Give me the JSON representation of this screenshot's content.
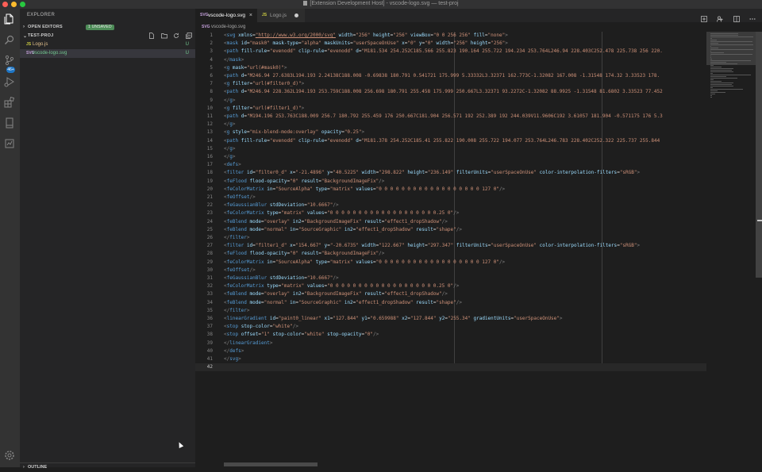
{
  "window": {
    "title": "[Extension Development Host] - vscode-logo.svg — test-proj"
  },
  "activity_bar": {
    "items": [
      "explorer-icon",
      "search-icon",
      "source-control-icon",
      "run-debug-icon",
      "extensions-icon",
      "notebook-icon",
      "test-icon"
    ],
    "source_control_badge": "46+",
    "settings": "gear-icon"
  },
  "sidebar": {
    "title": "EXPLORER",
    "open_editors": {
      "label": "OPEN EDITORS",
      "badge": "1 UNSAVED"
    },
    "project": {
      "label": "TEST-PROJ",
      "files": [
        {
          "icon": "JS",
          "name": "Logo.js",
          "status": "U",
          "color": "#e2c08d"
        },
        {
          "icon": "SVG",
          "name": "vscode-logo.svg",
          "status": "U",
          "color": "#73c991"
        }
      ]
    },
    "outline": {
      "label": "OUTLINE"
    }
  },
  "tabs": [
    {
      "icon": "SVG",
      "label": "vscode-logo.svg",
      "close": "×"
    },
    {
      "icon": "JS",
      "label": "Logo.js"
    }
  ],
  "breadcrumb": {
    "icon": "SVG",
    "label": "vscode-logo.svg"
  },
  "editor": {
    "current_line": 42,
    "lines": [
      "<svg xmlns=\"http://www.w3.org/2000/svg\" width=\"256\" height=\"256\" viewBox=\"0 0 256 256\" fill=\"none\">",
      "<mask id=\"mask0\" mask-type=\"alpha\" maskUnits=\"userSpaceOnUse\" x=\"0\" y=\"0\" width=\"256\" height=\"256\">",
      "<path fill-rule=\"evenodd\" clip-rule=\"evenodd\" d=\"M181.534 254.252C185.566 255.823 190.164 255.722 194.234 253.764L246.94 228.403C252.478 225.738 256 220.",
      "</mask>",
      "<g mask=\"url(#mask0)\">",
      "<path d=\"M246.94 27.6383L194.193 2.24138C188.008 -0.69838 180.791 0.541721 175.999 5.33332L3.32371 162.773C-1.32082 167.008 -1.31548 174.32 3.33523 178.",
      "<g filter=\"url(#filter0_d)\">",
      "<path d=\"M246.94 228.362L194.193 253.759C188.008 256.698 180.791 255.458 175.999 250.667L3.32371 93.2272C-1.32082 88.9925 -1.31548 81.6802 3.33523 77.452",
      "</g>",
      "<g filter=\"url(#filter1_d)\">",
      "<path d=\"M194.196 253.763C188.009 256.7 180.792 255.459 176 250.667C181.904 256.571 192 252.389 192 244.039V11.9606C192 3.61057 181.904 -0.571175 176 5.3",
      "</g>",
      "<g style=\"mix-blend-mode:overlay\" opacity=\"0.25\">",
      "<path fill-rule=\"evenodd\" clip-rule=\"evenodd\" d=\"M181.378 254.252C185.41 255.822 190.008 255.722 194.077 253.764L246.783 228.402C252.322 225.737 255.844",
      "</g>",
      "</g>",
      "<defs>",
      "<filter id=\"filter0_d\" x=\"-21.4896\" y=\"40.5225\" width=\"298.822\" height=\"236.149\" filterUnits=\"userSpaceOnUse\" color-interpolation-filters=\"sRGB\">",
      "<feFlood flood-opacity=\"0\" result=\"BackgroundImageFix\"/>",
      "<feColorMatrix in=\"SourceAlpha\" type=\"matrix\" values=\"0 0 0 0 0 0 0 0 0 0 0 0 0 0 0 0 0 0 127 0\"/>",
      "<feOffset/>",
      "<feGaussianBlur stdDeviation=\"10.6667\"/>",
      "<feColorMatrix type=\"matrix\" values=\"0 0 0 0 0 0 0 0 0 0 0 0 0 0 0 0 0 0 0.25 0\"/>",
      "<feBlend mode=\"overlay\" in2=\"BackgroundImageFix\" result=\"effect1_dropShadow\"/>",
      "<feBlend mode=\"normal\" in=\"SourceGraphic\" in2=\"effect1_dropShadow\" result=\"shape\"/>",
      "</filter>",
      "<filter id=\"filter1_d\" x=\"154.667\" y=\"-20.6735\" width=\"122.667\" height=\"297.347\" filterUnits=\"userSpaceOnUse\" color-interpolation-filters=\"sRGB\">",
      "<feFlood flood-opacity=\"0\" result=\"BackgroundImageFix\"/>",
      "<feColorMatrix in=\"SourceAlpha\" type=\"matrix\" values=\"0 0 0 0 0 0 0 0 0 0 0 0 0 0 0 0 0 0 127 0\"/>",
      "<feOffset/>",
      "<feGaussianBlur stdDeviation=\"10.6667\"/>",
      "<feColorMatrix type=\"matrix\" values=\"0 0 0 0 0 0 0 0 0 0 0 0 0 0 0 0 0 0 0.25 0\"/>",
      "<feBlend mode=\"overlay\" in2=\"BackgroundImageFix\" result=\"effect1_dropShadow\"/>",
      "<feBlend mode=\"normal\" in=\"SourceGraphic\" in2=\"effect1_dropShadow\" result=\"shape\"/>",
      "</filter>",
      "<linearGradient id=\"paint0_linear\" x1=\"127.844\" y1=\"0.659988\" x2=\"127.844\" y2=\"255.34\" gradientUnits=\"userSpaceOnUse\">",
      "<stop stop-color=\"white\"/>",
      "<stop offset=\"1\" stop-color=\"white\" stop-opacity=\"0\"/>",
      "</linearGradient>",
      "</defs>",
      "</svg>",
      ""
    ]
  }
}
